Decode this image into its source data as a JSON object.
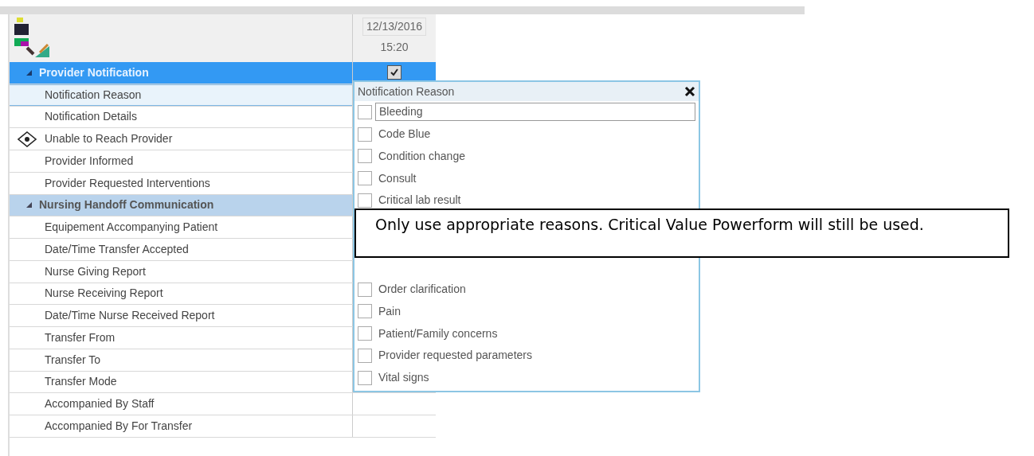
{
  "column_header": {
    "date": "12/13/2016",
    "time": "15:20"
  },
  "rows": [
    {
      "kind": "section",
      "label": "Provider Notification",
      "expanded": true,
      "selected": true,
      "value": {
        "checked": true
      }
    },
    {
      "kind": "item",
      "label": "Notification Reason",
      "selected": true,
      "marked": false
    },
    {
      "kind": "item",
      "label": "Notification Details",
      "selected": false,
      "marked": false
    },
    {
      "kind": "item",
      "label": "Unable to Reach Provider",
      "selected": false,
      "marked": true
    },
    {
      "kind": "item",
      "label": "Provider Informed",
      "selected": false,
      "marked": false
    },
    {
      "kind": "item",
      "label": "Provider Requested Interventions",
      "selected": false,
      "marked": false
    },
    {
      "kind": "section",
      "label": "Nursing Handoff Communication",
      "expanded": true,
      "selected": false
    },
    {
      "kind": "item",
      "label": "Equipement Accompanying Patient",
      "selected": false,
      "marked": false
    },
    {
      "kind": "item",
      "label": "Date/Time Transfer Accepted",
      "selected": false,
      "marked": false
    },
    {
      "kind": "item",
      "label": "Nurse Giving Report",
      "selected": false,
      "marked": false
    },
    {
      "kind": "item",
      "label": "Nurse Receiving Report",
      "selected": false,
      "marked": false
    },
    {
      "kind": "item",
      "label": "Date/Time Nurse Received Report",
      "selected": false,
      "marked": false
    },
    {
      "kind": "item",
      "label": "Transfer From",
      "selected": false,
      "marked": false
    },
    {
      "kind": "item",
      "label": "Transfer To",
      "selected": false,
      "marked": false
    },
    {
      "kind": "item",
      "label": "Transfer Mode",
      "selected": false,
      "marked": false
    },
    {
      "kind": "item",
      "label": "Accompanied By Staff",
      "selected": false,
      "marked": false
    },
    {
      "kind": "item",
      "label": "Accompanied By For Transfer",
      "selected": false,
      "marked": false
    }
  ],
  "popup": {
    "title": "Notification Reason",
    "options_above_note": [
      {
        "label": "Bleeding",
        "checked": false,
        "focused": true
      },
      {
        "label": "Code Blue",
        "checked": false,
        "focused": false
      },
      {
        "label": "Condition change",
        "checked": false,
        "focused": false
      },
      {
        "label": "Consult",
        "checked": false,
        "focused": false
      },
      {
        "label": "Critical lab result",
        "checked": false,
        "focused": false
      }
    ],
    "note": "Only use appropriate reasons. Critical Value Powerform will still be used.",
    "options_below_note": [
      {
        "label": "Order clarification",
        "checked": false,
        "focused": false
      },
      {
        "label": "Pain",
        "checked": false,
        "focused": false
      },
      {
        "label": "Patient/Family concerns",
        "checked": false,
        "focused": false
      },
      {
        "label": "Provider requested parameters",
        "checked": false,
        "focused": false
      },
      {
        "label": "Vital signs",
        "checked": false,
        "focused": false
      }
    ]
  }
}
